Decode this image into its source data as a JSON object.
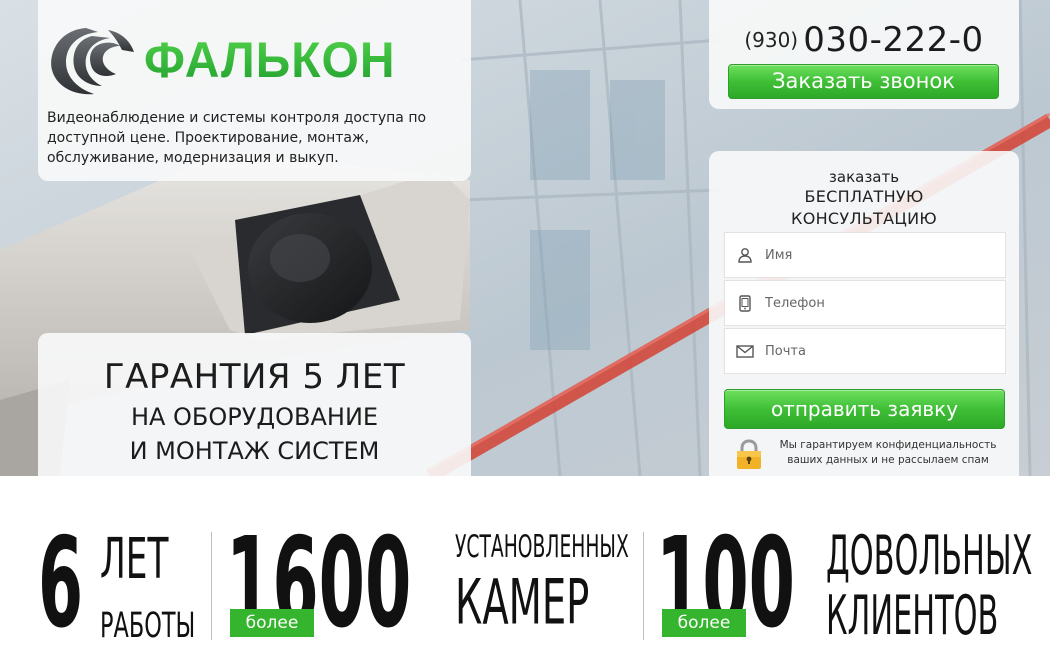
{
  "brand": {
    "name": "ФАЛЬКОН",
    "tagline": "Видеонаблюдение и системы контроля доступа по доступной цене. Проектирование, монтаж, обслуживание, модернизация и выкуп."
  },
  "guarantee": {
    "line1": "ГАРАНТИЯ 5 ЛЕТ",
    "line2": "НА ОБОРУДОВАНИЕ",
    "line3": "И МОНТАЖ СИСТЕМ"
  },
  "contact": {
    "phone_code": "(930)",
    "phone_number": "030-222-0",
    "call_button": "Заказать звонок"
  },
  "form": {
    "title_line1": "заказать",
    "title_line2": "БЕСПЛАТНУЮ",
    "title_line3": "КОНСУЛЬТАЦИЮ",
    "name_placeholder": "Имя",
    "phone_placeholder": "Телефон",
    "email_placeholder": "Почта",
    "submit_label": "отправить заявку",
    "privacy_line1": "Мы гарантируем конфиденциальность",
    "privacy_line2": "ваших данных и не рассылаем спам"
  },
  "stats": {
    "years": {
      "number": "6",
      "line1": "ЛЕТ",
      "line2": "РАБОТЫ"
    },
    "cameras": {
      "badge": "более",
      "number": "1600",
      "line1": "УСТАНОВЛЕННЫХ",
      "line2": "КАМЕР"
    },
    "clients": {
      "badge": "более",
      "number": "100",
      "line1": "ДОВОЛЬНЫХ",
      "line2": "КЛИЕНТОВ"
    }
  },
  "colors": {
    "accent_green": "#3fbf36",
    "logo_green": "#1f9d2f",
    "text_dark": "#111111"
  },
  "icons": {
    "logo_mark": "falcon-head-icon",
    "name_field": "user-icon",
    "phone_field": "phone-icon",
    "email_field": "envelope-icon",
    "privacy": "padlock-icon"
  }
}
